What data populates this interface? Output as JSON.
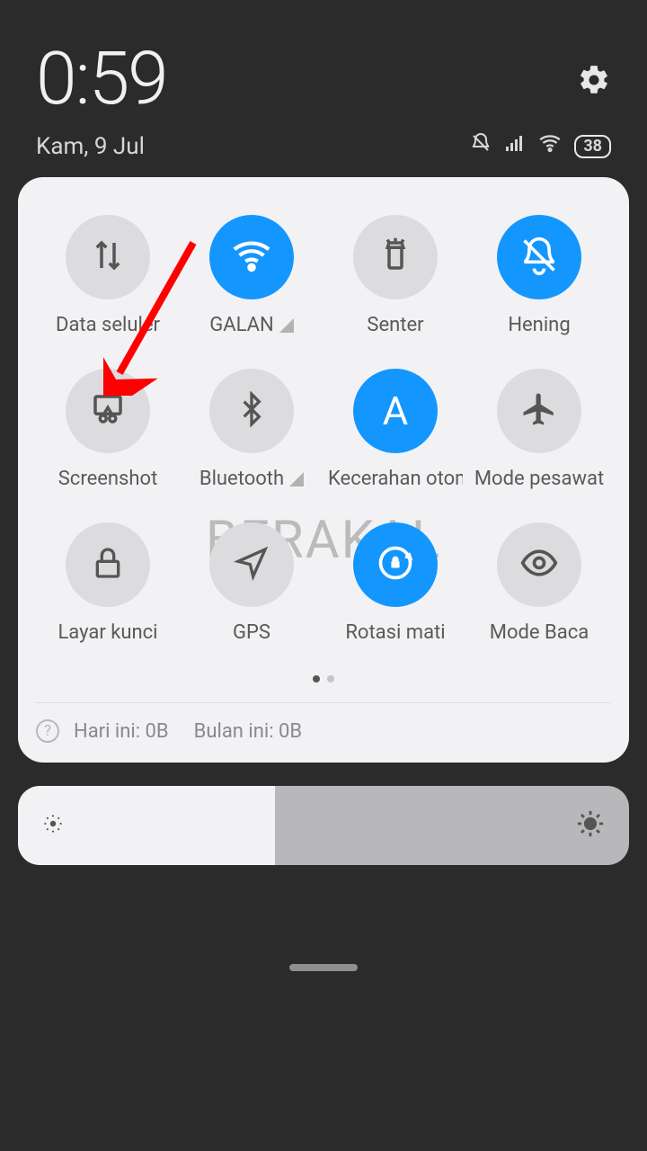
{
  "header": {
    "time": "0:59",
    "date": "Kam, 9 Jul",
    "battery": "38"
  },
  "watermark": "BERAKAL",
  "tiles": {
    "r0c0": "Data seluler",
    "r0c1": "GALAN",
    "r0c2": "Senter",
    "r0c3": "Hening",
    "r1c0": "Screenshot",
    "r1c1": "Bluetooth",
    "r1c2": "Kecerahan otomatis",
    "r1c3": "Mode pesawat",
    "r2c0": "Layar kunci",
    "r2c1": "GPS",
    "r2c2": "Rotasi mati",
    "r2c3": "Mode Baca"
  },
  "usage": {
    "today": "Hari ini: 0B",
    "month": "Bulan ini: 0B"
  }
}
